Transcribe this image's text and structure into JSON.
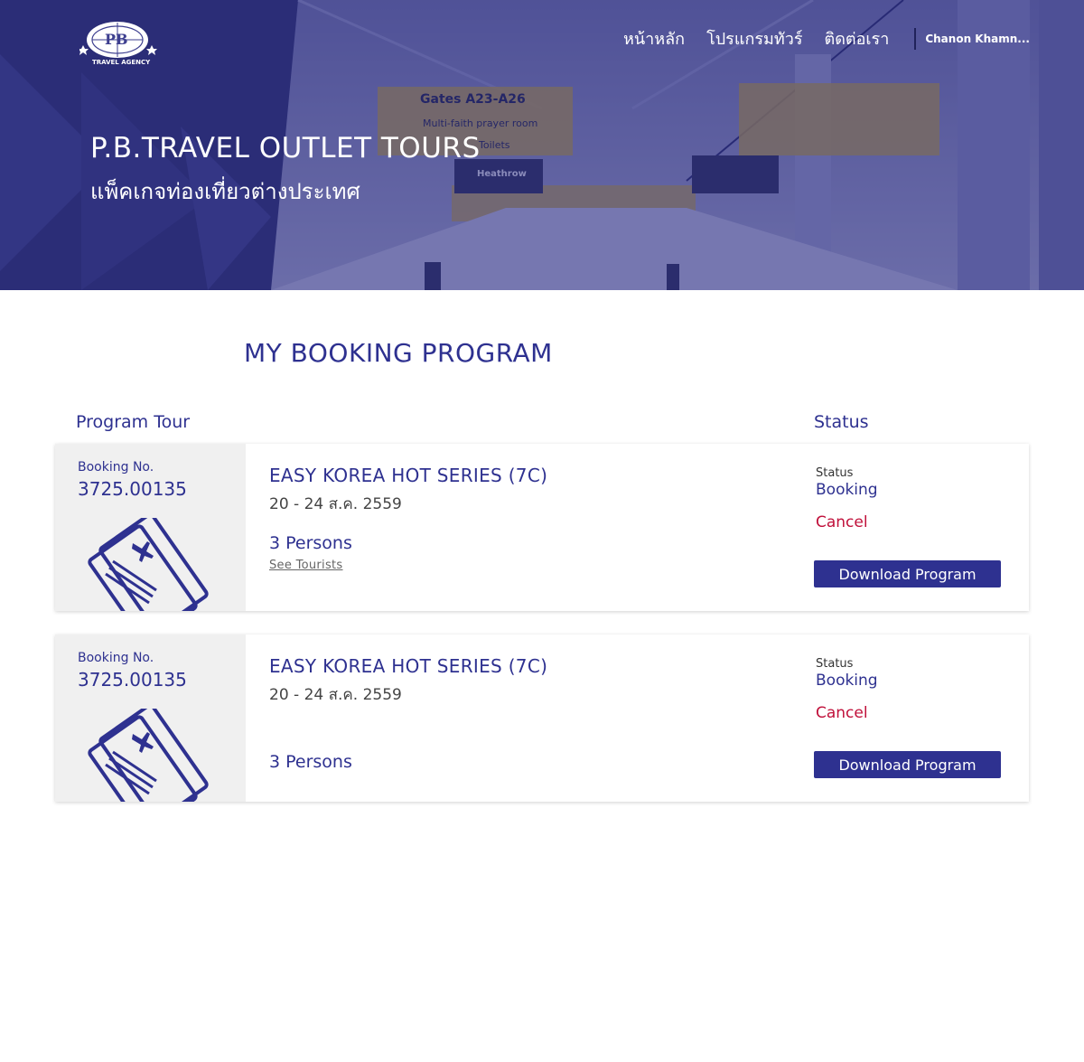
{
  "header": {
    "logo_text": "P.B. TRAVEL AGENCY",
    "nav": [
      {
        "label": "หน้าหลัก"
      },
      {
        "label": "โปรแกรมทัวร์"
      },
      {
        "label": "ติดต่อเรา"
      }
    ],
    "user_name": "Chanon Khamn..."
  },
  "hero": {
    "title": "P.B.TRAVEL OUTLET TOURS",
    "subtitle": "แพ็คเกจท่องเที่ยวต่างประเทศ",
    "signs": [
      "Gates A23-A26",
      "Multi-faith prayer room",
      "Toilets",
      "Heathrow"
    ]
  },
  "main": {
    "title": "MY BOOKING PROGRAM",
    "columns": {
      "tour": "Program Tour",
      "status": "Status"
    },
    "bookings": [
      {
        "booking_label": "Booking No.",
        "booking_no": "3725.00135",
        "tour_name": "EASY KOREA HOT SERIES (7C)",
        "dates": "20 - 24 ส.ค. 2559",
        "persons": "3 Persons",
        "see_tourists": "See Tourists",
        "status_label": "Status",
        "status_value": "Booking",
        "cancel": "Cancel",
        "download": "Download Program"
      },
      {
        "booking_label": "Booking No.",
        "booking_no": "3725.00135",
        "tour_name": "EASY KOREA HOT SERIES (7C)",
        "dates": "20 - 24 ส.ค. 2559",
        "persons": "3 Persons",
        "status_label": "Status",
        "status_value": "Booking",
        "cancel": "Cancel",
        "download": "Download Program"
      }
    ]
  },
  "colors": {
    "primary": "#2e3190",
    "cancel": "#c0103a",
    "card_left_bg": "#f0f0f0"
  }
}
